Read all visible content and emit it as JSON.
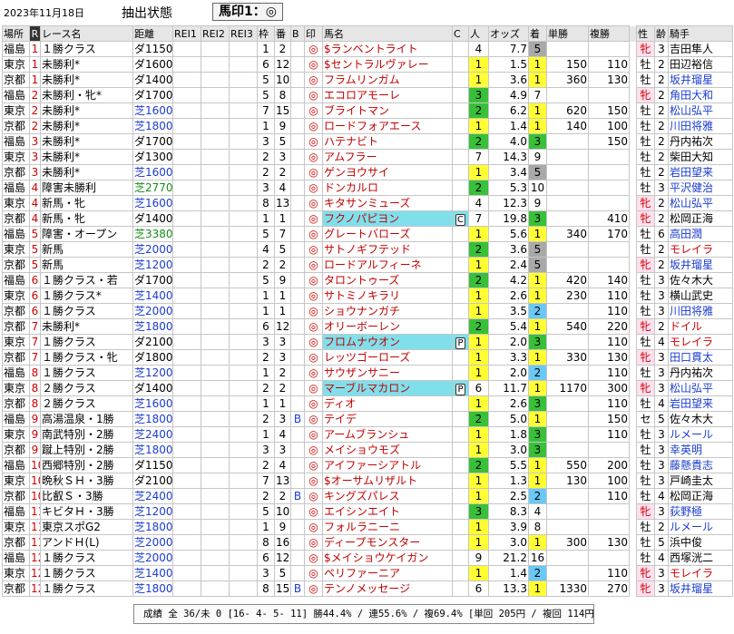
{
  "header": {
    "date": "2023年11月18日",
    "extract_label": "抽出状態",
    "filter": "馬印1：◎"
  },
  "columns": {
    "ba": "場所",
    "r": "R",
    "race": "レース名",
    "dist": "距離",
    "rei1": "REI1",
    "rei2": "REI2",
    "rei3": "REI3",
    "waku": "枠",
    "uma": "番",
    "b": "B",
    "mark": "印",
    "horse": "馬名",
    "c": "C",
    "pop": "人",
    "odds": "オッズ",
    "pos": "着",
    "win": "単勝",
    "plc": "複勝",
    "sex": "性",
    "age": "齢",
    "jockey": "騎手"
  },
  "rows": [
    {
      "ba": "福島",
      "r": "1",
      "race": "１勝クラス",
      "dist": "ダ1150",
      "dt": "dirt",
      "waku": "1",
      "uma": "2",
      "ub": "",
      "b": "",
      "mark": "◎",
      "horse": "$ランベントライト",
      "hl": false,
      "c": "",
      "pop": "4",
      "popc": "",
      "odds": "7.7",
      "pos": "5",
      "posc": "gry",
      "win": "",
      "plc": "",
      "sex": "牝",
      "age": "3",
      "jockey": "吉田隼人",
      "jc": ""
    },
    {
      "ba": "東京",
      "r": "1",
      "race": "未勝利*",
      "dist": "ダ1600",
      "dt": "dirt",
      "waku": "6",
      "uma": "12",
      "ub": "",
      "b": "",
      "mark": "◎",
      "horse": "$セントラルヴァレー",
      "hl": false,
      "c": "",
      "pop": "1",
      "popc": "ylw",
      "odds": "1.5",
      "pos": "1",
      "posc": "ylw",
      "win": "150",
      "plc": "110",
      "sex": "牡",
      "age": "2",
      "jockey": "田辺裕信",
      "jc": ""
    },
    {
      "ba": "京都",
      "r": "1",
      "race": "未勝利*",
      "dist": "ダ1400",
      "dt": "dirt",
      "waku": "5",
      "uma": "10",
      "ub": "",
      "b": "",
      "mark": "◎",
      "horse": "フラムリンガム",
      "hl": false,
      "c": "",
      "pop": "1",
      "popc": "ylw",
      "odds": "3.6",
      "pos": "1",
      "posc": "ylw",
      "win": "360",
      "plc": "130",
      "sex": "牡",
      "age": "2",
      "jockey": "坂井瑠星",
      "jc": "blue"
    },
    {
      "ba": "福島",
      "r": "2",
      "race": "未勝利・牝*",
      "dist": "ダ1700",
      "dt": "dirt",
      "waku": "5",
      "uma": "8",
      "ub": "",
      "b": "",
      "mark": "◎",
      "horse": "エコロアモーレ",
      "hl": false,
      "c": "",
      "pop": "3",
      "popc": "grn",
      "odds": "4.9",
      "pos": "7",
      "posc": "",
      "win": "",
      "plc": "",
      "sex": "牝",
      "age": "2",
      "jockey": "角田大和",
      "jc": "blue"
    },
    {
      "ba": "東京",
      "r": "2",
      "race": "未勝利*",
      "dist": "芝1600",
      "dt": "turf",
      "waku": "7",
      "uma": "15",
      "ub": "",
      "b": "",
      "mark": "◎",
      "horse": "ブライトマン",
      "hl": false,
      "c": "",
      "pop": "2",
      "popc": "grn",
      "odds": "6.2",
      "pos": "1",
      "posc": "ylw",
      "win": "620",
      "plc": "150",
      "sex": "牡",
      "age": "2",
      "jockey": "松山弘平",
      "jc": "blue"
    },
    {
      "ba": "京都",
      "r": "2",
      "race": "未勝利*",
      "dist": "芝1800",
      "dt": "turf",
      "waku": "1",
      "uma": "9",
      "ub": "",
      "b": "",
      "mark": "◎",
      "horse": "ロードフォアエース",
      "hl": false,
      "c": "",
      "pop": "1",
      "popc": "ylw",
      "odds": "1.4",
      "pos": "1",
      "posc": "ylw",
      "win": "140",
      "plc": "100",
      "sex": "牡",
      "age": "2",
      "jockey": "川田将雅",
      "jc": "blue"
    },
    {
      "ba": "福島",
      "r": "3",
      "race": "未勝利*",
      "dist": "ダ1700",
      "dt": "dirt",
      "waku": "3",
      "uma": "5",
      "ub": "",
      "b": "",
      "mark": "◎",
      "horse": "ハテナビト",
      "hl": false,
      "c": "",
      "pop": "2",
      "popc": "grn",
      "odds": "4.0",
      "pos": "3",
      "posc": "grn",
      "win": "",
      "plc": "150",
      "sex": "牡",
      "age": "2",
      "jockey": "丹内祐次",
      "jc": ""
    },
    {
      "ba": "東京",
      "r": "3",
      "race": "未勝利*",
      "dist": "ダ1300",
      "dt": "dirt",
      "waku": "2",
      "uma": "3",
      "ub": "",
      "b": "",
      "mark": "◎",
      "horse": "アムフラー",
      "hl": false,
      "c": "",
      "pop": "7",
      "popc": "",
      "odds": "14.3",
      "pos": "9",
      "posc": "",
      "win": "",
      "plc": "",
      "sex": "牡",
      "age": "2",
      "jockey": "柴田大知",
      "jc": ""
    },
    {
      "ba": "京都",
      "r": "3",
      "race": "未勝利*",
      "dist": "芝1600",
      "dt": "turf",
      "waku": "2",
      "uma": "2",
      "ub": "",
      "b": "",
      "mark": "◎",
      "horse": "ゲンヨウサイ",
      "hl": false,
      "c": "",
      "pop": "1",
      "popc": "ylw",
      "odds": "3.4",
      "pos": "5",
      "posc": "gry",
      "win": "",
      "plc": "",
      "sex": "牡",
      "age": "2",
      "jockey": "岩田望来",
      "jc": "blue"
    },
    {
      "ba": "福島",
      "r": "4",
      "race": "障害未勝利",
      "dist": "芝2770",
      "dt": "steep",
      "waku": "3",
      "uma": "4",
      "ub": "",
      "b": "",
      "mark": "◎",
      "horse": "ドンカルロ",
      "hl": false,
      "c": "",
      "pop": "2",
      "popc": "grn",
      "odds": "5.3",
      "pos": "10",
      "posc": "",
      "win": "",
      "plc": "",
      "sex": "牡",
      "age": "3",
      "jockey": "平沢健治",
      "jc": "blue"
    },
    {
      "ba": "東京",
      "r": "4",
      "race": "新馬・牝",
      "dist": "芝1600",
      "dt": "turf",
      "waku": "8",
      "uma": "13",
      "ub": "",
      "b": "",
      "mark": "◎",
      "horse": "キタサンミューズ",
      "hl": false,
      "c": "",
      "pop": "4",
      "popc": "",
      "odds": "12.3",
      "pos": "9",
      "posc": "",
      "win": "",
      "plc": "",
      "sex": "牝",
      "age": "2",
      "jockey": "松山弘平",
      "jc": "blue"
    },
    {
      "ba": "京都",
      "r": "4",
      "race": "新馬・牝",
      "dist": "ダ1400",
      "dt": "dirt",
      "waku": "1",
      "uma": "1",
      "ub": "",
      "b": "",
      "mark": "◎",
      "horse": "フクノパピヨン",
      "hl": true,
      "c": "C",
      "pop": "7",
      "popc": "",
      "odds": "19.8",
      "pos": "3",
      "posc": "grn",
      "win": "",
      "plc": "410",
      "sex": "牝",
      "age": "2",
      "jockey": "松岡正海",
      "jc": ""
    },
    {
      "ba": "福島",
      "r": "5",
      "race": "障害・オープン",
      "dist": "芝3380",
      "dt": "steep",
      "waku": "5",
      "uma": "7",
      "ub": "",
      "b": "",
      "mark": "◎",
      "horse": "グレートバローズ",
      "hl": false,
      "c": "",
      "pop": "1",
      "popc": "ylw",
      "odds": "5.6",
      "pos": "1",
      "posc": "ylw",
      "win": "340",
      "plc": "170",
      "sex": "牡",
      "age": "6",
      "jockey": "高田潤",
      "jc": "blue"
    },
    {
      "ba": "東京",
      "r": "5",
      "race": "新馬",
      "dist": "芝2000",
      "dt": "turf",
      "waku": "4",
      "uma": "5",
      "ub": "",
      "b": "",
      "mark": "◎",
      "horse": "サトノギフテッド",
      "hl": false,
      "c": "",
      "pop": "2",
      "popc": "grn",
      "odds": "3.6",
      "pos": "5",
      "posc": "gry",
      "win": "",
      "plc": "",
      "sex": "牡",
      "age": "2",
      "jockey": "モレイラ",
      "jc": "red"
    },
    {
      "ba": "京都",
      "r": "5",
      "race": "新馬",
      "dist": "芝1200",
      "dt": "turf",
      "waku": "2",
      "uma": "2",
      "ub": "",
      "b": "",
      "mark": "◎",
      "horse": "ロードアルフィーネ",
      "hl": false,
      "c": "",
      "pop": "1",
      "popc": "ylw",
      "odds": "2.4",
      "pos": "5",
      "posc": "gry",
      "win": "",
      "plc": "",
      "sex": "牝",
      "age": "2",
      "jockey": "坂井瑠星",
      "jc": "blue"
    },
    {
      "ba": "福島",
      "r": "6",
      "race": "１勝クラス・若",
      "dist": "ダ1700",
      "dt": "dirt",
      "waku": "5",
      "uma": "9",
      "ub": "",
      "b": "",
      "mark": "◎",
      "horse": "タロントゥーズ",
      "hl": false,
      "c": "",
      "pop": "2",
      "popc": "grn",
      "odds": "4.2",
      "pos": "1",
      "posc": "ylw",
      "win": "420",
      "plc": "140",
      "sex": "牡",
      "age": "3",
      "jockey": "佐々木大",
      "jc": ""
    },
    {
      "ba": "東京",
      "r": "6",
      "race": "１勝クラス*",
      "dist": "芝1400",
      "dt": "turf",
      "waku": "1",
      "uma": "1",
      "ub": "",
      "b": "",
      "mark": "◎",
      "horse": "サトミノキラリ",
      "hl": false,
      "c": "",
      "pop": "1",
      "popc": "ylw",
      "odds": "2.6",
      "pos": "1",
      "posc": "ylw",
      "win": "230",
      "plc": "110",
      "sex": "牡",
      "age": "3",
      "jockey": "横山武史",
      "jc": ""
    },
    {
      "ba": "京都",
      "r": "6",
      "race": "１勝クラス",
      "dist": "芝2000",
      "dt": "turf",
      "waku": "1",
      "uma": "1",
      "ub": "",
      "b": "",
      "mark": "◎",
      "horse": "ショウナンガチ",
      "hl": false,
      "c": "",
      "pop": "1",
      "popc": "ylw",
      "odds": "3.5",
      "pos": "2",
      "posc": "blu",
      "win": "",
      "plc": "110",
      "sex": "牡",
      "age": "3",
      "jockey": "川田将雅",
      "jc": "blue"
    },
    {
      "ba": "京都",
      "r": "7",
      "race": "未勝利*",
      "dist": "芝1800",
      "dt": "turf",
      "waku": "6",
      "uma": "12",
      "ub": "",
      "b": "",
      "mark": "◎",
      "horse": "オリーボーレン",
      "hl": false,
      "c": "",
      "pop": "2",
      "popc": "grn",
      "odds": "5.4",
      "pos": "1",
      "posc": "ylw",
      "win": "540",
      "plc": "220",
      "sex": "牝",
      "age": "2",
      "jockey": "ドイル",
      "jc": "red"
    },
    {
      "ba": "東京",
      "r": "7",
      "race": "１勝クラス",
      "dist": "ダ2100",
      "dt": "dirt",
      "waku": "3",
      "uma": "3",
      "ub": "",
      "b": "",
      "mark": "◎",
      "horse": "フロムナウオン",
      "hl": true,
      "c": "P",
      "pop": "1",
      "popc": "ylw",
      "odds": "2.0",
      "pos": "3",
      "posc": "grn",
      "win": "",
      "plc": "110",
      "sex": "牡",
      "age": "4",
      "jockey": "モレイラ",
      "jc": "red"
    },
    {
      "ba": "京都",
      "r": "7",
      "race": "１勝クラス・牝",
      "dist": "ダ1800",
      "dt": "dirt",
      "waku": "2",
      "uma": "3",
      "ub": "",
      "b": "",
      "mark": "◎",
      "horse": "レッツゴーローズ",
      "hl": false,
      "c": "",
      "pop": "1",
      "popc": "ylw",
      "odds": "3.3",
      "pos": "1",
      "posc": "ylw",
      "win": "330",
      "plc": "130",
      "sex": "牝",
      "age": "3",
      "jockey": "田口貫太",
      "jc": "blue"
    },
    {
      "ba": "福島",
      "r": "8",
      "race": "１勝クラス",
      "dist": "芝1200",
      "dt": "turf",
      "waku": "1",
      "uma": "2",
      "ub": "",
      "b": "",
      "mark": "◎",
      "horse": "サウザンサニー",
      "hl": false,
      "c": "",
      "pop": "1",
      "popc": "ylw",
      "odds": "2.0",
      "pos": "2",
      "posc": "blu",
      "win": "",
      "plc": "110",
      "sex": "牡",
      "age": "3",
      "jockey": "丹内祐次",
      "jc": ""
    },
    {
      "ba": "東京",
      "r": "8",
      "race": "２勝クラス",
      "dist": "ダ1400",
      "dt": "dirt",
      "waku": "2",
      "uma": "2",
      "ub": "",
      "b": "",
      "mark": "◎",
      "horse": "マーブルマカロン",
      "hl": true,
      "c": "P",
      "pop": "6",
      "popc": "",
      "odds": "11.7",
      "pos": "1",
      "posc": "ylw",
      "win": "1170",
      "plc": "300",
      "sex": "牝",
      "age": "3",
      "jockey": "松山弘平",
      "jc": "blue"
    },
    {
      "ba": "京都",
      "r": "8",
      "race": "２勝クラス",
      "dist": "芝1600",
      "dt": "turf",
      "waku": "1",
      "uma": "1",
      "ub": "",
      "b": "",
      "mark": "◎",
      "horse": "ディオ",
      "hl": false,
      "c": "",
      "pop": "1",
      "popc": "ylw",
      "odds": "2.6",
      "pos": "3",
      "posc": "grn",
      "win": "",
      "plc": "110",
      "sex": "牡",
      "age": "4",
      "jockey": "岩田望来",
      "jc": "blue"
    },
    {
      "ba": "福島",
      "r": "9",
      "race": "高湯温泉・1勝",
      "dist": "芝1800",
      "dt": "turf",
      "waku": "2",
      "uma": "3",
      "ub": "",
      "b": "B",
      "mark": "◎",
      "horse": "テイデ",
      "hl": false,
      "c": "",
      "pop": "2",
      "popc": "grn",
      "odds": "5.0",
      "pos": "1",
      "posc": "ylw",
      "win": "",
      "plc": "150",
      "sex": "セ",
      "age": "5",
      "jockey": "佐々木大",
      "jc": ""
    },
    {
      "ba": "東京",
      "r": "9",
      "race": "南武特別・2勝",
      "dist": "芝2400",
      "dt": "turf",
      "waku": "1",
      "uma": "4",
      "ub": "",
      "b": "",
      "mark": "◎",
      "horse": "アームブランシュ",
      "hl": false,
      "c": "",
      "pop": "1",
      "popc": "ylw",
      "odds": "1.8",
      "pos": "3",
      "posc": "grn",
      "win": "",
      "plc": "110",
      "sex": "牡",
      "age": "3",
      "jockey": "ルメール",
      "jc": "blue"
    },
    {
      "ba": "京都",
      "r": "9",
      "race": "蹴上特別・2勝",
      "dist": "芝1800",
      "dt": "turf",
      "waku": "3",
      "uma": "3",
      "ub": "",
      "b": "",
      "mark": "◎",
      "horse": "メイショウモズ",
      "hl": false,
      "c": "",
      "pop": "1",
      "popc": "ylw",
      "odds": "3.0",
      "pos": "3",
      "posc": "grn",
      "win": "",
      "plc": "",
      "sex": "牡",
      "age": "3",
      "jockey": "幸英明",
      "jc": "blue"
    },
    {
      "ba": "福島",
      "r": "10",
      "race": "西郷特別・2勝",
      "dist": "ダ1150",
      "dt": "dirt",
      "waku": "2",
      "uma": "4",
      "ub": "",
      "b": "",
      "mark": "◎",
      "horse": "アイファーシアトル",
      "hl": false,
      "c": "",
      "pop": "2",
      "popc": "grn",
      "odds": "5.5",
      "pos": "1",
      "posc": "ylw",
      "win": "550",
      "plc": "200",
      "sex": "牡",
      "age": "3",
      "jockey": "藤懸貴志",
      "jc": "blue"
    },
    {
      "ba": "東京",
      "r": "10",
      "race": "晩秋ＳＨ・3勝",
      "dist": "ダ2100",
      "dt": "dirt",
      "waku": "7",
      "uma": "13",
      "ub": "",
      "b": "",
      "mark": "◎",
      "horse": "$オーサムリザルト",
      "hl": false,
      "c": "",
      "pop": "1",
      "popc": "ylw",
      "odds": "1.3",
      "pos": "1",
      "posc": "ylw",
      "win": "130",
      "plc": "100",
      "sex": "牡",
      "age": "3",
      "jockey": "戸崎圭太",
      "jc": ""
    },
    {
      "ba": "京都",
      "r": "10",
      "race": "比叡Ｓ・3勝",
      "dist": "芝2400",
      "dt": "turf",
      "waku": "2",
      "uma": "2",
      "ub": "",
      "b": "B",
      "mark": "◎",
      "horse": "キングズパレス",
      "hl": false,
      "c": "",
      "pop": "1",
      "popc": "ylw",
      "odds": "2.5",
      "pos": "2",
      "posc": "blu",
      "win": "",
      "plc": "110",
      "sex": "牡",
      "age": "4",
      "jockey": "松岡正海",
      "jc": ""
    },
    {
      "ba": "福島",
      "r": "11",
      "race": "キビタＨ・3勝",
      "dist": "芝1200",
      "dt": "turf",
      "waku": "5",
      "uma": "10",
      "ub": "",
      "b": "",
      "mark": "◎",
      "horse": "エイシンエイト",
      "hl": false,
      "c": "",
      "pop": "3",
      "popc": "grn",
      "odds": "8.3",
      "pos": "4",
      "posc": "",
      "win": "",
      "plc": "",
      "sex": "牝",
      "age": "3",
      "jockey": "荻野極",
      "jc": "blue"
    },
    {
      "ba": "東京",
      "r": "11",
      "race": "東京スポG2",
      "dist": "芝1800",
      "dt": "turf",
      "waku": "1",
      "uma": "9",
      "ub": "",
      "b": "",
      "mark": "◎",
      "horse": "フォルラニーニ",
      "hl": false,
      "c": "",
      "pop": "1",
      "popc": "ylw",
      "odds": "3.9",
      "pos": "8",
      "posc": "",
      "win": "",
      "plc": "",
      "sex": "牡",
      "age": "2",
      "jockey": "ルメール",
      "jc": "blue"
    },
    {
      "ba": "京都",
      "r": "11",
      "race": "アンドＨ(L)",
      "dist": "芝2000",
      "dt": "turf",
      "waku": "8",
      "uma": "16",
      "ub": "",
      "b": "",
      "mark": "◎",
      "horse": "ディープモンスター",
      "hl": false,
      "c": "",
      "pop": "1",
      "popc": "ylw",
      "odds": "3.0",
      "pos": "1",
      "posc": "ylw",
      "win": "300",
      "plc": "130",
      "sex": "牡",
      "age": "5",
      "jockey": "浜中俊",
      "jc": ""
    },
    {
      "ba": "福島",
      "r": "12",
      "race": "１勝クラス",
      "dist": "芝2000",
      "dt": "turf",
      "waku": "6",
      "uma": "12",
      "ub": "",
      "b": "",
      "mark": "◎",
      "horse": "$メイショウケイガン",
      "hl": false,
      "c": "",
      "pop": "9",
      "popc": "",
      "odds": "21.2",
      "pos": "16",
      "posc": "",
      "win": "",
      "plc": "",
      "sex": "牡",
      "age": "4",
      "jockey": "西塚洸二",
      "jc": ""
    },
    {
      "ba": "東京",
      "r": "12",
      "race": "１勝クラス",
      "dist": "芝1400",
      "dt": "turf",
      "waku": "3",
      "uma": "5",
      "ub": "",
      "b": "",
      "mark": "◎",
      "horse": "ペリファーニア",
      "hl": false,
      "c": "",
      "pop": "1",
      "popc": "ylw",
      "odds": "1.4",
      "pos": "2",
      "posc": "blu",
      "win": "",
      "plc": "110",
      "sex": "牝",
      "age": "3",
      "jockey": "モレイラ",
      "jc": "red"
    },
    {
      "ba": "京都",
      "r": "12",
      "race": "１勝クラス",
      "dist": "芝1800",
      "dt": "turf",
      "waku": "8",
      "uma": "15",
      "ub": "",
      "b": "B",
      "mark": "◎",
      "horse": "テンノメッセージ",
      "hl": false,
      "c": "",
      "pop": "6",
      "popc": "",
      "odds": "13.3",
      "pos": "1",
      "posc": "ylw",
      "win": "1330",
      "plc": "270",
      "sex": "牝",
      "age": "3",
      "jockey": "坂井瑠星",
      "jc": "blue"
    }
  ],
  "footer": {
    "summary": "成績 全 36/未  0  [16- 4- 5- 11] 勝44.4% / 連55.6% / 複69.4% [単回 205円 / 複回 114円]"
  }
}
